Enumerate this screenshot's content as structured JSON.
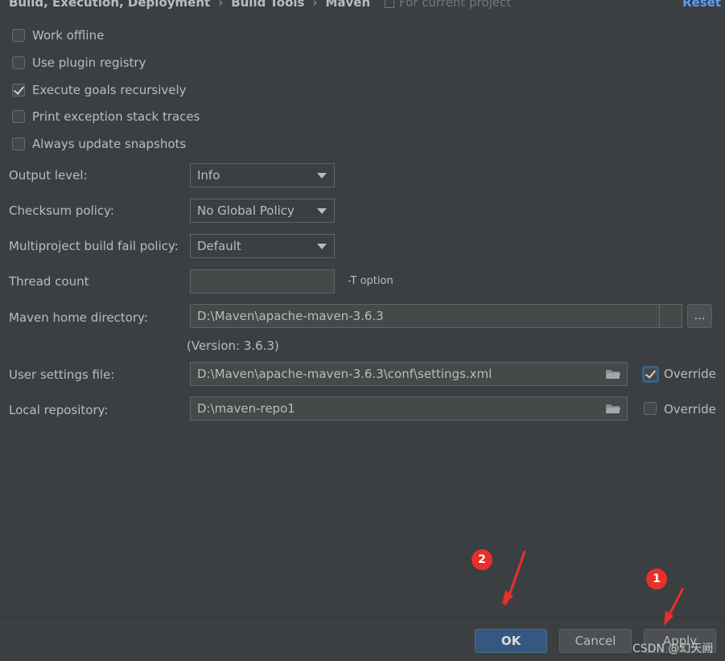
{
  "breadcrumb": [
    "Build, Execution, Deployment",
    "Build Tools",
    "Maven"
  ],
  "breadcrumb_sep": "›",
  "scope_text": "For current project",
  "reset_label": "Reset",
  "checkboxes": [
    {
      "label": "Work offline",
      "checked": false
    },
    {
      "label": "Use plugin registry",
      "checked": false
    },
    {
      "label": "Execute goals recursively",
      "checked": true
    },
    {
      "label": "Print exception stack traces",
      "checked": false
    },
    {
      "label": "Always update snapshots",
      "checked": false
    }
  ],
  "form": {
    "output_level": {
      "label": "Output level:",
      "value": "Info"
    },
    "checksum_policy": {
      "label": "Checksum policy:",
      "value": "No Global Policy"
    },
    "fail_policy": {
      "label": "Multiproject build fail policy:",
      "value": "Default"
    },
    "thread_count": {
      "label": "Thread count",
      "value": "",
      "hint": "-T option"
    },
    "maven_home": {
      "label": "Maven home directory:",
      "value": "D:\\Maven\\apache-maven-3.6.3",
      "browse": "...",
      "version": "(Version: 3.6.3)"
    },
    "user_settings": {
      "label": "User settings file:",
      "value": "D:\\Maven\\apache-maven-3.6.3\\conf\\settings.xml",
      "override_label": "Override",
      "override_checked": true
    },
    "local_repo": {
      "label": "Local repository:",
      "value": "D:\\maven-repo1",
      "override_label": "Override",
      "override_checked": false
    }
  },
  "buttons": {
    "ok": "OK",
    "cancel": "Cancel",
    "apply": "Apply"
  },
  "annotations": {
    "badge_1": "1",
    "badge_2": "2",
    "color": "#e8302b"
  },
  "watermark": "CSDN @幻天阙",
  "colors": {
    "background": "#3c3f41",
    "text": "#bbbbbb",
    "accent": "#589df6",
    "primary_button": "#365880"
  }
}
